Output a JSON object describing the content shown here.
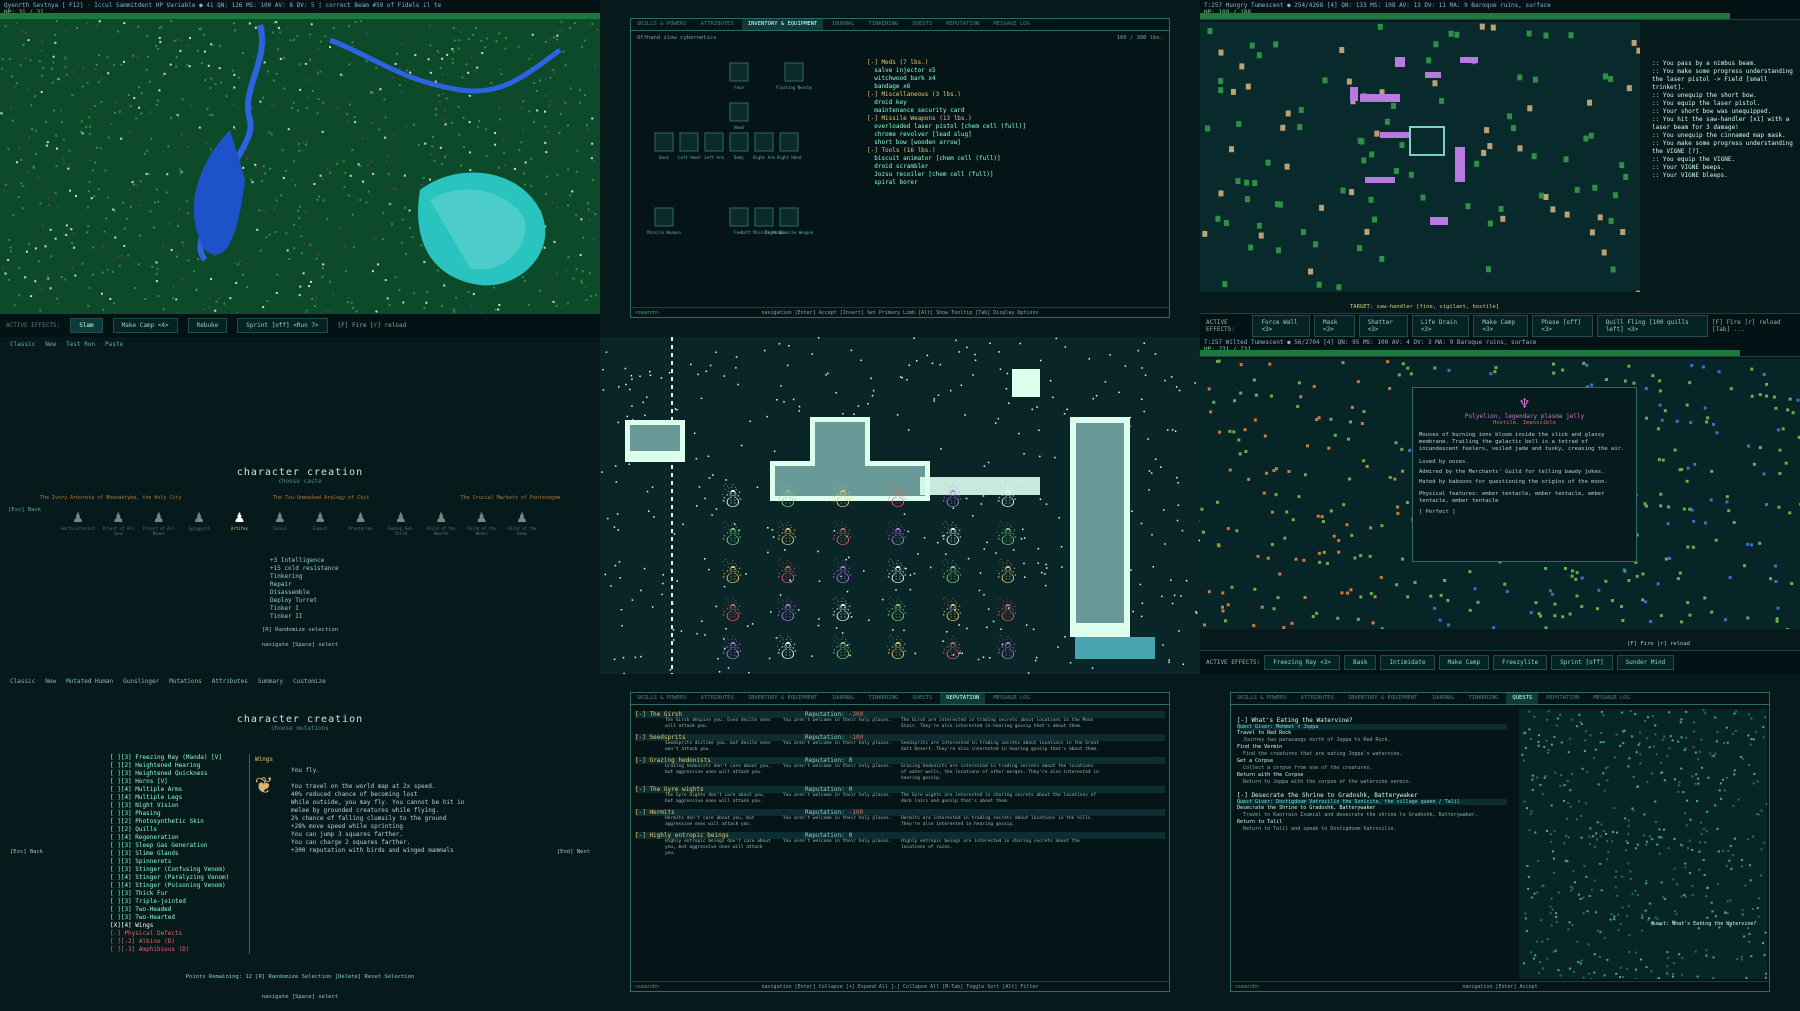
{
  "panel1": {
    "hud_line1": "Qyenrth Sevtnya   [ F12] ·   Iccul Sammitdent   HP Variable ●  41   QN: 126  MS: 100  AV: 8  DV: 5  |  correct Beam #59 of Fidels   il te",
    "hud_line2": "HP: 31 / 31",
    "hud_line3": "LVL: 1  Exp: 0 / 220",
    "abilities": [
      "Slam",
      "Make Camp <4>",
      "Rebuke",
      "Sprint [off] <Run 7>"
    ],
    "fire_text": "[F] Fire [r] reload",
    "effects_label": "ACTIVE EFFECTS:"
  },
  "panel2": {
    "tabs": [
      "SKILLS & POWERS",
      "ATTRIBUTES",
      "INVENTORY & EQUIPMENT",
      "JOURNAL",
      "TINKERING",
      "QUESTS",
      "REPUTATION",
      "MESSAGE LOG"
    ],
    "selected_tab": "INVENTORY & EQUIPMENT",
    "header_left": "Offhand slow cybernetics",
    "weight": "160 / 300 lbs.",
    "inventory": [
      "[-] Meds (7 lbs.)",
      "  salve injector x5",
      "  witchwood bark x4",
      "  bandage x6",
      "[-] Miscellaneous (3 lbs.)",
      "  droid key",
      "  maintenance security card",
      "[-] Missile Weapons (13 lbs.)",
      "  overloaded laser pistol [chem cell (full)]",
      "  chrome revolver [lead slug]",
      "  short bow [wooden arrow]",
      "[-] Tools (16 lbs.)",
      "  biscuit animator [chem cell (full)]",
      "  droid scrambler",
      "  Jozsu recoiler [chem cell (full)]",
      "  spiral borer"
    ],
    "equip_labels": [
      "Face",
      "Floating Nearby",
      "Head",
      "Back",
      "Left Hand",
      "Left Arm",
      "Body",
      "Right Arm",
      "Right Hand",
      "Missile Weapon",
      "Feet",
      "Left Missile Weapon",
      "Right Missile Weapon"
    ],
    "footer": "navigation  [Enter] Accept  [Insert] Set Primary Limb  [Alt] Show Tooltip  [Tab] Display Options",
    "search": "<search>"
  },
  "panel3": {
    "hud_line1": "T:257   Hungry  Tumescent   ● 254/4268 [4]     QN: 133  MS: 108  AV: 13  DV: 11  MA: 9    Baroque ruins, surface",
    "hud_line2": "HP: 188 / 188",
    "hud_line3": "LVL: 22  Exp: 581169 / 539159",
    "log": [
      "You pass by a nimbus beam.",
      "You make some progress understanding the laser pistol -> Field [small trinket].",
      "You unequip the short bow.",
      "You equip the laser pistol.",
      "Your short bow was unequipped.",
      "You hit the saw-handler [x1] with a laser beam for 3 damage!",
      "You unequip the cinnamed map mask.",
      "You make some progress understanding the VIGNE [?].",
      "You equip the VIGNE.",
      "Your VIGNE beeps.",
      "Your VIGNE bleeps."
    ],
    "target_line": "TARGET: saw-handler [fine, vigilant, hostile]",
    "abilities": [
      "Force Wall <3>",
      "Mask <3>",
      "Shatter <3>",
      "Life Drain <3>",
      "Make Camp <3>",
      "Phase [off] <3>",
      "Quill Fling [100 quills left] <3>"
    ],
    "fire_text": "[F] Fire  [r] reload  [Tab] ...",
    "effects_label": "ACTIVE EFFECTS:"
  },
  "panel4": {
    "toolbar": [
      "Classic",
      "New",
      "Test Run",
      "Paste"
    ],
    "title": "character creation",
    "subtitle": "choose caste",
    "groups": [
      "The Ivory Arboreta of Bhenaktybe, the Holy City",
      "The Tzu-Unmasked Aralogy of Ckit",
      "The Crucial Markets of Fentenogem"
    ],
    "caste_labels": [
      "Horticulturist",
      "Priest of All Suns",
      "Priest of All Moons",
      "Syzygyrch",
      "Artifex",
      "Consul",
      "Eunuch",
      "Praetorian",
      "Fuming God-Child",
      "Child of the Hearth",
      "Child of the Wheel",
      "Child of the Deep"
    ],
    "selected_caste": "Artifex",
    "bonus_list": [
      "+3 Intelligence",
      "+15 cold resistance",
      "Tinkering",
      "Repair",
      "Disassemble",
      "Deploy Turret",
      "Tinker I",
      "Tinker II"
    ],
    "back": "[Esc] Back",
    "randomize": "[R] Randomize selection",
    "nav": "navigate  [Space] select"
  },
  "panel6": {
    "hud_line1": "T:257   Wilted  Tumescent   ● 56/2704 [4]     QN: 95  MS: 100  AV: 4  DV: 3  MA: 9    Baroque ruins, surface",
    "hud_line2": "HP: 231 / 231",
    "hud_line3": "LVL: 25  Exp: 509106 / 539159",
    "popup_name": "Polyelion, legendary plasma jelly",
    "popup_tag": "Hostile, Impossible",
    "popup_desc": "Mouses of burning ions bloom inside the slick and glassy membrane. Trailing the galactic bell is a tetrad of incandescent feelers, veiled jade and tusky, creasing the air.",
    "popup_loved": "Loved by oozes.",
    "popup_admired": "Admired by the Merchants' Guild for telling bawdy jokes.",
    "popup_hated": "Hated by baboons for questioning the origins of the moon.",
    "popup_features": "Physical features: ember tentacle, ember tentacle, ember tentacle, ember tentacle",
    "popup_health": "[ Perfect ]",
    "abilities": [
      "Freezing Ray <3>",
      "Bask",
      "Intimidate",
      "Make Camp",
      "Freezylite",
      "Sprint [off]",
      "Sunder Mind"
    ],
    "fire_text": "[F] Fire  [r] reload",
    "effects_label": "ACTIVE EFFECTS:"
  },
  "panel7": {
    "toolbar": [
      "Classic",
      "New",
      "Mutated Human",
      "Gunslinger",
      "Mutations",
      "Attributes",
      "Summary",
      "Customize"
    ],
    "title": "character creation",
    "subtitle": "choose mutations",
    "mutations": [
      "[ ][3] Freezing Ray (Manda) [V]",
      "[ ][2] Heightened Hearing",
      "[ ][3] Heightened Quickness",
      "[ ][3] Horns [V]",
      "[ ][4] Multiple Arms",
      "[ ][4] Multiple Legs",
      "[ ][3] Night Vision",
      "[ ][3] Phasing",
      "[ ][2] Photosynthetic Skin",
      "[ ][2] Quills",
      "[ ][4] Regeneration",
      "[ ][3] Sleep Gas Generation",
      "[ ][3] Slime Glands",
      "[ ][3] Spinnerets",
      "[ ][3] Stinger (Confusing Venom)",
      "[ ][4] Stinger (Paralyzing Venom)",
      "[ ][4] Stinger (Poisoning Venom)",
      "[ ][3] Thick Fur",
      "[ ][3] Triple-jointed",
      "[ ][3] Two-Headed",
      "[ ][3] Two-Hearted",
      "[X][4] Wings"
    ],
    "defects_header": "[-] Physical Defects",
    "defects": [
      "[ ][-2] Albino (D)",
      "[ ][-3] Amphibious (D)"
    ],
    "detail_title": "Wings",
    "detail_lines": [
      "You fly.",
      "",
      "You travel on the world map at 2x speed.",
      "40% reduced chance of becoming lost",
      "While outside, you may fly. You cannot be hit in",
      "melee by grounded creatures while flying.",
      "2% chance of falling clumsily to the ground",
      "+28% move speed while sprinting",
      "You can jump 3 squares farther.",
      "You can charge 2 squares farther.",
      "+300 reputation with birds and winged mammals"
    ],
    "points": "Points Remaining: 12  [R] Randomize Selection  [Delete] Reset Selection",
    "back": "[Esc] Back",
    "next": "[End] Next",
    "nav": "navigate  [Space] select"
  },
  "panel8": {
    "tabs": [
      "SKILLS & POWERS",
      "ATTRIBUTES",
      "INVENTORY & EQUIPMENT",
      "JOURNAL",
      "TINKERING",
      "QUESTS",
      "REPUTATION",
      "MESSAGE LOG"
    ],
    "selected_tab": "REPUTATION",
    "factions": [
      {
        "name": "The Girsh",
        "rep": "-300",
        "a": "The Girsh despise you. Even docile ones will attack you.",
        "b": "You aren't welcome in their holy places.",
        "c": "The Girsh are interested in trading secrets about locations in the Moon Stair. They're also interested in hearing gossip that's about them."
      },
      {
        "name": "Seedsprits",
        "rep": "-100",
        "a": "Seedsprits dislike you, but docile ones won't attack you.",
        "b": "You aren't welcome in their holy places.",
        "c": "Seedsprits are interested in trading secrets about locations in the Great Salt Desert. They're also interested in hearing gossip that's about them."
      },
      {
        "name": "Grazing hedonists",
        "rep": "0",
        "a": "Grazing hedonists don't care about you, but aggressive ones will attack you.",
        "b": "You aren't welcome in their holy places.",
        "c": "Grazing hedonists are interested in trading secrets about the locations of water wells, the locations of other merges. They're also interested in hearing gossip."
      },
      {
        "name": "The Gyre wights",
        "rep": "0",
        "a": "The Gyre wights don't care about you, but aggressive ones will attack you.",
        "b": "You aren't welcome in their holy places.",
        "c": "The Gyre wights are interested in sharing secrets about the locations of dark lairs and gossip that's about them."
      },
      {
        "name": "Hermits",
        "rep": "-100",
        "a": "Hermits don't care about you, but aggressive ones will attack you.",
        "b": "You aren't welcome in their holy places.",
        "c": "Hermits are interested in trading secrets about locations in the hills. They're also interested in hearing gossip."
      },
      {
        "name": "Highly entropic beings",
        "rep": "0",
        "a": "Highly entropic beings don't care about you, but aggressive ones will attack you.",
        "b": "You aren't welcome in their holy places.",
        "c": "Highly entropic beings are interested in sharing secrets about the locations of ruins."
      }
    ],
    "rep_label": "Reputation:",
    "footer": "navigation  [Enter] Collapse  [+] Expand All  [-] Collapse All  [M-Tab] Toggle Sort  [Alt] Filter",
    "search": "<search>"
  },
  "panel9": {
    "tabs": [
      "SKILLS & POWERS",
      "ATTRIBUTES",
      "INVENTORY & EQUIPMENT",
      "JOURNAL",
      "TINKERING",
      "QUESTS",
      "REPUTATION",
      "MESSAGE LOG"
    ],
    "selected_tab": "QUESTS",
    "quests": [
      {
        "title": "[-] What's Eating the Watervine?",
        "giver": "Quest Giver: Mehmet < Joppa",
        "steps": [
          "Travel to Red Rock",
          "  Journey two parasangs north of Joppa to Red Rock.",
          "Find the Vermin",
          "  Find the creatures that are eating Joppa's watervine.",
          "Get a Corpse",
          "  Collect a corpse from one of the creatures.",
          "Return with the Corpse",
          "  Return to Joppa with the corpse of the watervine vermin."
        ]
      },
      {
        "title": "[-] Desecrate the Shrine to Gradoshk, Batterywaker",
        "giver": "Quest Giver: Dostigdoom Vatrocilio the Sonicite, the village queen / Talil",
        "steps": [
          "Desecrate the Shrine to Gradoshk, Batterywaker",
          "  Travel to Kaorrain Ixumial and desecrate the shrine to Gradoshk, Batterywaker.",
          "Return to Talil",
          "  Return to Talil and speak to Dostigdoom Vatrocilio."
        ]
      }
    ],
    "map_marker": "Quest: What's Eating the Watervine?",
    "footer": "navigation  [Enter] Accept",
    "search": "<search>"
  },
  "colors": {
    "bg": "#041a1c",
    "border": "#2f6a66",
    "grass": "#1f7a3a",
    "water": "#1d52c9",
    "hp": "#1c7a3e"
  }
}
